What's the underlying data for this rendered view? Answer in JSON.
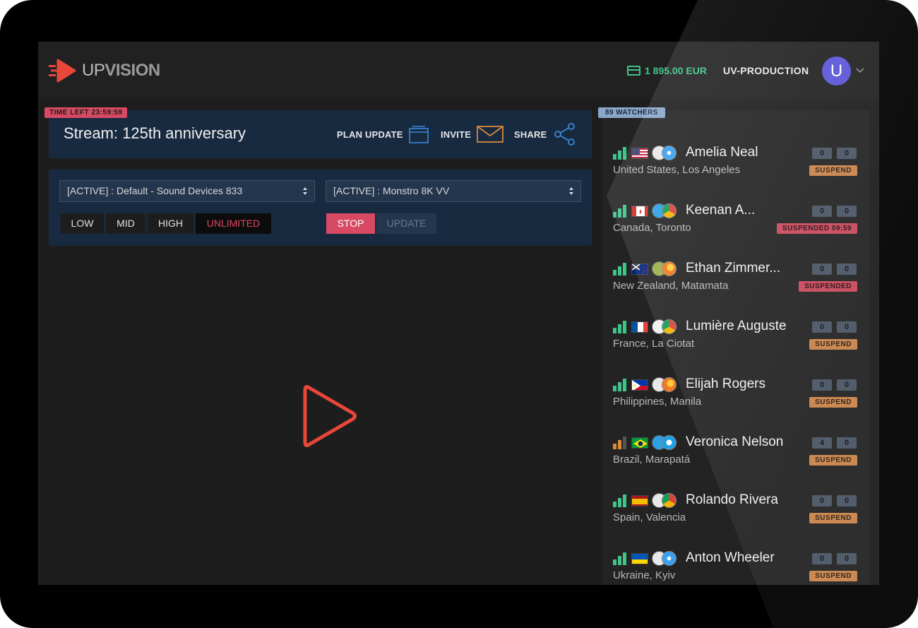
{
  "header": {
    "logo_prefix": "UP",
    "logo_suffix": "VISION",
    "balance": "1 895.00 EUR",
    "organization": "UV-PRODUCTION",
    "avatar_letter": "U",
    "balance_color": "#3ec58a",
    "avatar_color": "#5b55d6"
  },
  "stream": {
    "time_left": "TIME LEFT 23:59:59",
    "title": "Stream: 125th anniversary",
    "actions": [
      {
        "label": "PLAN UPDATE",
        "icon": "calendar-icon"
      },
      {
        "label": "INVITE",
        "icon": "envelope-icon"
      },
      {
        "label": "SHARE",
        "icon": "share-icon"
      }
    ]
  },
  "controls": {
    "audio_source": "[ACTIVE] : Default - Sound Devices 833",
    "video_source": "[ACTIVE] : Monstro 8K VV",
    "quality": [
      "LOW",
      "MID",
      "HIGH",
      "UNLIMITED"
    ],
    "quality_selected": "UNLIMITED",
    "stop_label": "STOP",
    "update_label": "UPDATE"
  },
  "watchers": {
    "badge": "89 WATCHERS",
    "items": [
      {
        "name": "Amelia Neal",
        "location": "United States, Los Angeles",
        "count_a": "0",
        "count_b": "0",
        "status": "SUSPEND",
        "signal": "good",
        "flag": "us-flag-icon",
        "os": "apple-icon",
        "browser": "safari-icon"
      },
      {
        "name": "Keenan A...",
        "location": "Canada, Toronto",
        "count_a": "0",
        "count_b": "0",
        "status": "SUSPENDED 09:59",
        "signal": "good",
        "flag": "canada-flag-icon",
        "os": "windows-icon",
        "browser": "chrome-icon"
      },
      {
        "name": "Ethan Zimmer...",
        "location": "New Zealand, Matamata",
        "count_a": "0",
        "count_b": "0",
        "status": "SUSPENDED",
        "signal": "good",
        "flag": "new-zealand-flag-icon",
        "os": "android-icon",
        "browser": "firefox-icon"
      },
      {
        "name": "Lumière Auguste",
        "location": "France, La Ciotat",
        "count_a": "0",
        "count_b": "0",
        "status": "SUSPEND",
        "signal": "good",
        "flag": "france-flag-icon",
        "os": "linux-icon",
        "browser": "chrome-icon"
      },
      {
        "name": "Elijah Rogers",
        "location": "Philippines, Manila",
        "count_a": "0",
        "count_b": "0",
        "status": "SUSPEND",
        "signal": "good",
        "flag": "philippines-flag-icon",
        "os": "apple-icon",
        "browser": "firefox-icon"
      },
      {
        "name": "Veronica Nelson",
        "location": "Brazil, Marapatá",
        "count_a": "4",
        "count_b": "0",
        "status": "SUSPEND",
        "signal": "medium",
        "flag": "brazil-flag-icon",
        "os": "windows-icon",
        "browser": "ie-icon"
      },
      {
        "name": "Rolando Rivera",
        "location": "Spain, Valencia",
        "count_a": "0",
        "count_b": "0",
        "status": "SUSPEND",
        "signal": "good",
        "flag": "spain-flag-icon",
        "os": "apple-icon",
        "browser": "chrome-icon"
      },
      {
        "name": "Anton Wheeler",
        "location": "Ukraine, Kyiv",
        "count_a": "0",
        "count_b": "0",
        "status": "SUSPEND",
        "signal": "good",
        "flag": "ukraine-flag-icon",
        "os": "apple-icon",
        "browser": "safari-icon"
      }
    ]
  }
}
